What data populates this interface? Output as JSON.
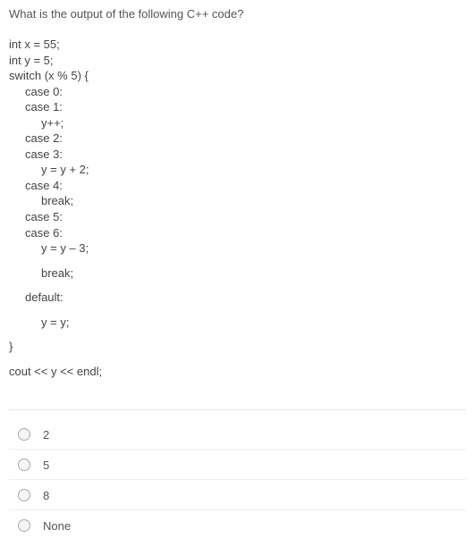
{
  "question": "What is the output of the following C++ code?",
  "code": {
    "l01": "int x = 55;",
    "l02": "int y = 5;",
    "l03": "switch (x % 5) {",
    "l04": "case 0:",
    "l05": "case 1:",
    "l06": "y++;",
    "l07": "case 2:",
    "l08": "case 3:",
    "l09": "y = y + 2;",
    "l10": "case 4:",
    "l11": "break;",
    "l12": "case 5:",
    "l13": "case 6:",
    "l14": "y = y – 3;",
    "l15": "break;",
    "l16": "default:",
    "l17": "y = y;",
    "l18": "}",
    "l19": "cout << y << endl;"
  },
  "options": [
    {
      "label": "2"
    },
    {
      "label": "5"
    },
    {
      "label": "8"
    },
    {
      "label": "None"
    }
  ]
}
